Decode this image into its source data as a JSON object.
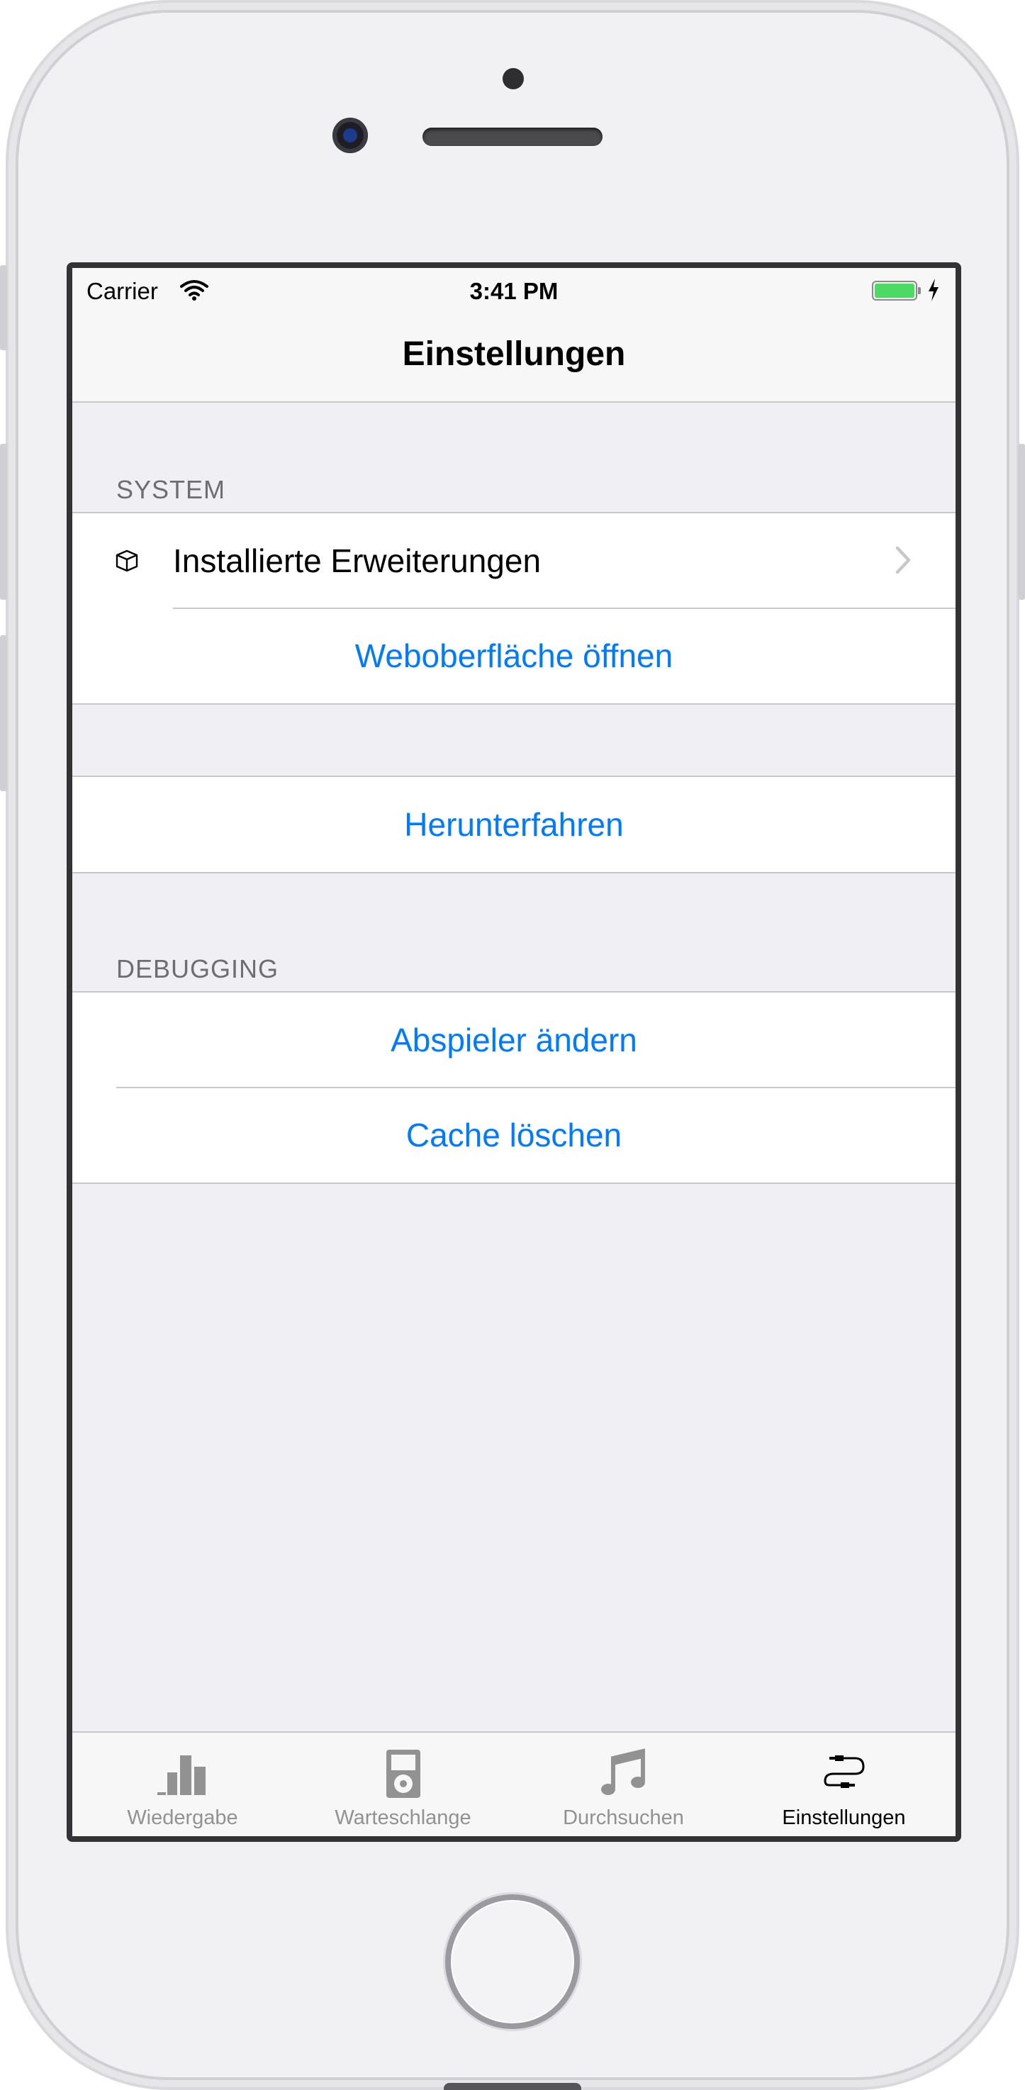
{
  "status_bar": {
    "carrier": "Carrier",
    "time": "3:41 PM",
    "wifi_icon": "wifi-icon",
    "battery_icon": "battery-icon",
    "battery_color": "#4cd964",
    "charging_icon": "bolt-icon"
  },
  "nav": {
    "title": "Einstellungen"
  },
  "sections": {
    "system_header": "SYSTEM",
    "installed_extensions": {
      "label": "Installierte Erweiterungen",
      "icon": "box-icon",
      "accessory": "chevron-right-icon"
    },
    "open_web_ui": "Weboberfläche öffnen",
    "shutdown": "Herunterfahren",
    "debugging_header": "DEBUGGING",
    "change_player": "Abspieler ändern",
    "clear_cache": "Cache löschen"
  },
  "tabs": [
    {
      "label": "Wiedergabe",
      "icon": "bar-chart-icon",
      "active": false
    },
    {
      "label": "Warteschlange",
      "icon": "ipod-icon",
      "active": false
    },
    {
      "label": "Durchsuchen",
      "icon": "music-note-icon",
      "active": false
    },
    {
      "label": "Einstellungen",
      "icon": "cable-icon",
      "active": true
    }
  ],
  "colors": {
    "tint": "#007aff",
    "background": "#efeff4",
    "inactive_tab": "#929292",
    "separator": "#c8c7cc"
  }
}
